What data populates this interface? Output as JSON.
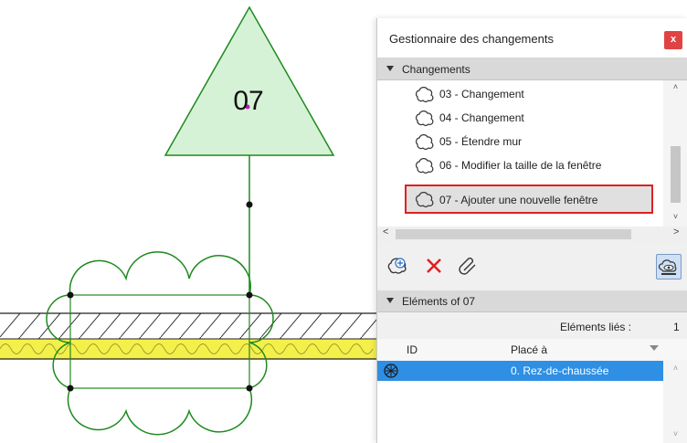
{
  "drawing": {
    "marker_label": "07"
  },
  "panel": {
    "title": "Gestionnaire des changements",
    "close_label": "x",
    "changes_section": {
      "title": "Changements",
      "items": [
        {
          "label": "03 - Changement",
          "selected": false
        },
        {
          "label": "04 - Changement",
          "selected": false
        },
        {
          "label": "05 - Étendre mur",
          "selected": false
        },
        {
          "label": "06 - Modifier la taille de la fenêtre",
          "selected": false
        },
        {
          "label": "07 - Ajouter une nouvelle fenêtre",
          "selected": true
        }
      ]
    },
    "toolbar": {
      "icons": [
        "new-change-icon",
        "delete-icon",
        "link-icon",
        "show-changes-icon"
      ]
    },
    "elements_section": {
      "title": "Eléments of 07",
      "linked_label": "Eléments liés :",
      "linked_count": "1",
      "columns": [
        "ID",
        "Placé à"
      ],
      "rows": [
        {
          "icon": "element-icon",
          "id": "",
          "placed_at": "0. Rez-de-chaussée"
        }
      ]
    },
    "colors": {
      "accent_select": "#2e8fe4",
      "highlight_border": "#e02020",
      "close_button": "#e04343",
      "drawing_green": "#1e8a1e",
      "marker_fill": "#d6f2d6",
      "insulation_yellow": "#f4f04a"
    }
  }
}
